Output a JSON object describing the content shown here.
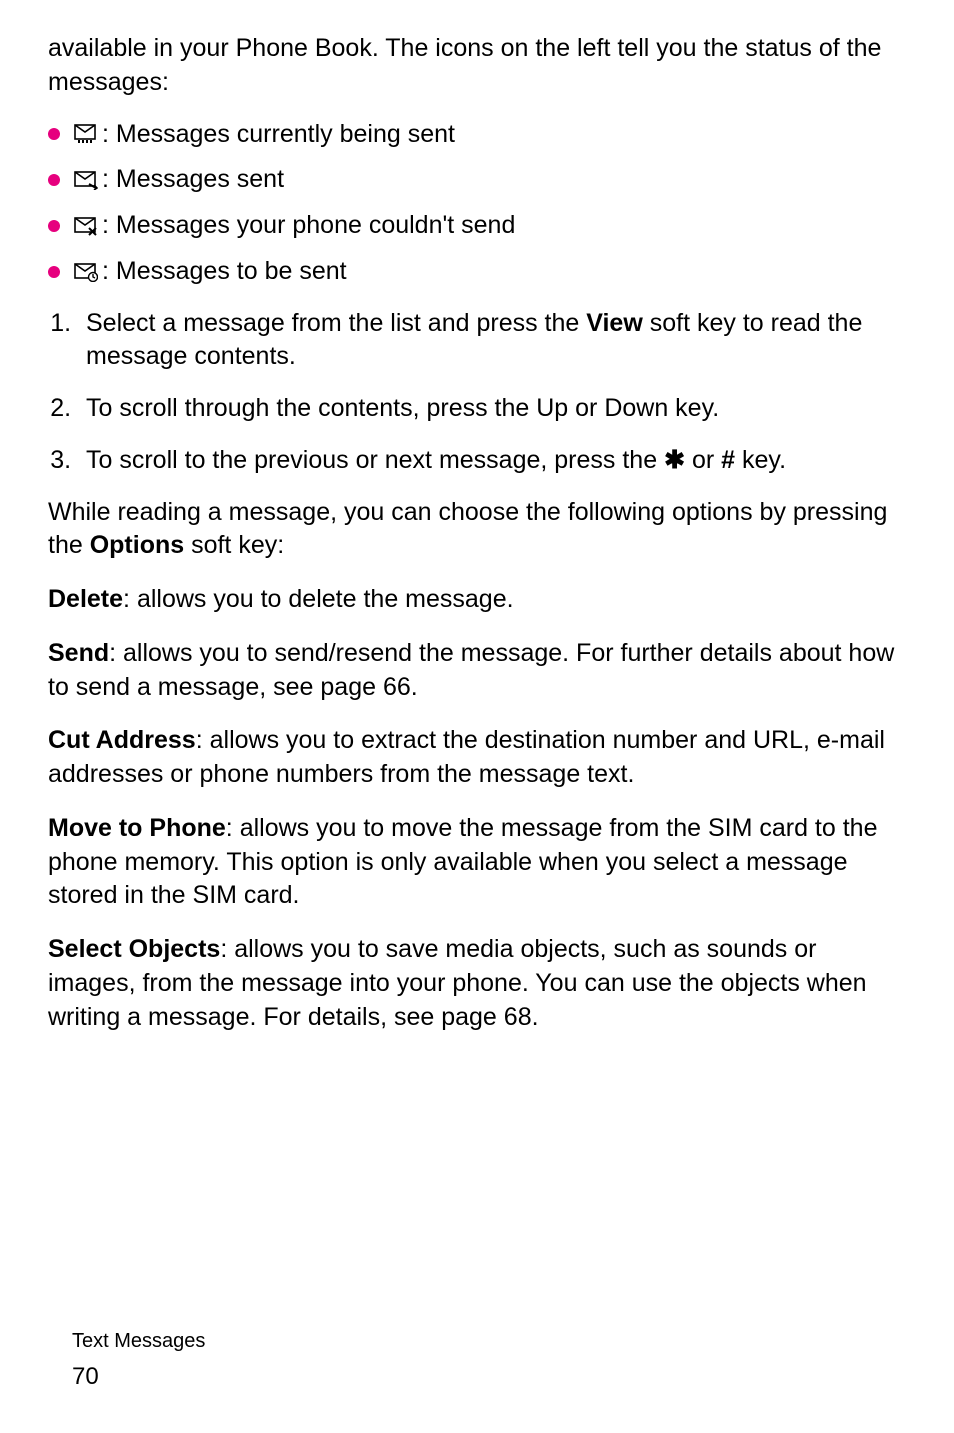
{
  "intro": "available in your Phone Book. The icons on the left tell you the status of the messages:",
  "iconList": [
    {
      "label": ": Messages currently being sent"
    },
    {
      "label": ": Messages sent"
    },
    {
      "label": ": Messages your phone couldn't send"
    },
    {
      "label": ": Messages to be sent"
    }
  ],
  "steps": {
    "s1a": "Select a message from the list and press the ",
    "s1b": "View",
    "s1c": " soft key to read the message contents.",
    "s2": "To scroll through the contents, press the Up or Down key.",
    "s3a": "To scroll to the previous or next message, press the ",
    "s3b": " or ",
    "s3c": " key."
  },
  "optionsIntro": {
    "a": "While reading a message, you can choose the following options by pressing the ",
    "b": "Options",
    "c": " soft key:"
  },
  "opts": {
    "delete": {
      "t": "Delete",
      "d": ": allows you to delete the message."
    },
    "send": {
      "t": "Send",
      "d": ": allows you to send/resend the message. For further details about how to send a message, see page 66."
    },
    "cut": {
      "t": "Cut Address",
      "d": ": allows you to extract the destination number and URL, e-mail addresses or phone numbers from the message text."
    },
    "move": {
      "t": "Move to Phone",
      "d": ": allows you to move the message from the SIM card to the phone memory. This option is only available when you select a message stored in the SIM card."
    },
    "select": {
      "t": "Select Objects",
      "d": ": allows you to save media objects, such as sounds or images, from the message into your phone. You can use the objects when writing a message. For details, see page 68."
    }
  },
  "footer": {
    "section": "Text Messages",
    "page": "70"
  },
  "keys": {
    "star": "✱",
    "hash": "#"
  }
}
